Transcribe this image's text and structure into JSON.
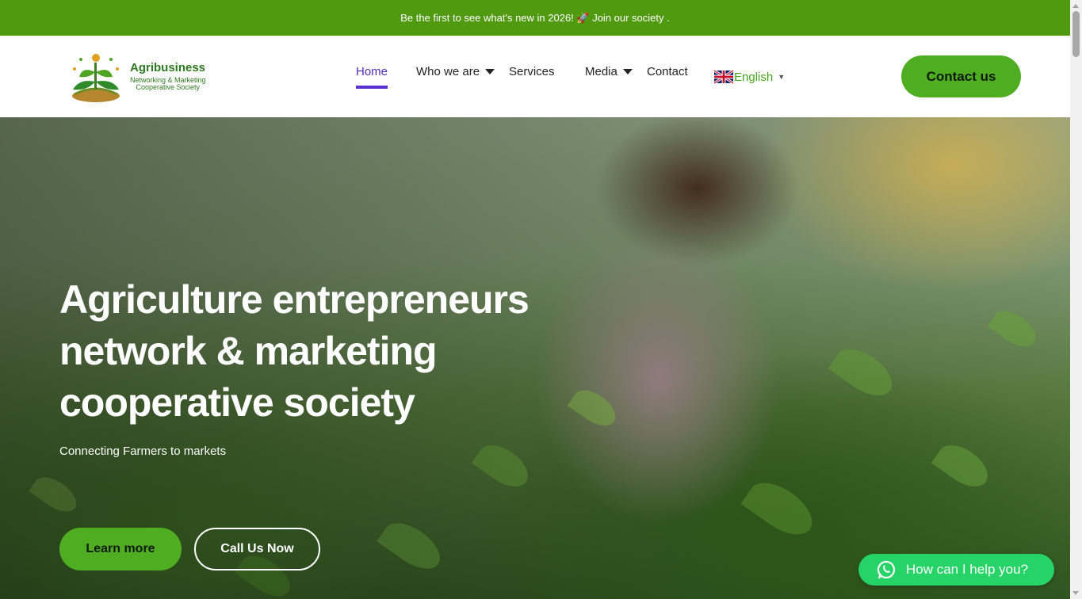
{
  "announcement": {
    "text": "Be the first to see what's new in 2026! 🚀 Join our society ."
  },
  "logo": {
    "line1": "Agribusiness",
    "line2": "Networking & Marketing",
    "line3": "Cooperative Society"
  },
  "nav": {
    "items": [
      {
        "label": "Home",
        "active": true,
        "dropdown": false
      },
      {
        "label": "Who we are",
        "active": false,
        "dropdown": true
      },
      {
        "label": "Services",
        "active": false,
        "dropdown": false
      },
      {
        "label": "Media",
        "active": false,
        "dropdown": true
      },
      {
        "label": "Contact",
        "active": false,
        "dropdown": false
      }
    ],
    "language": "English"
  },
  "header": {
    "contact_button": "Contact us"
  },
  "hero": {
    "title_line1": "Agriculture entrepreneurs",
    "title_line2": "network & marketing",
    "title_line3": "cooperative society",
    "subtitle": "Connecting Farmers to markets",
    "learn_more": "Learn more",
    "call_now": "Call Us Now"
  },
  "whatsapp": {
    "label": "How can I help you?"
  },
  "colors": {
    "brand_green": "#4fad22",
    "topbar_green": "#4f9a0f",
    "active_nav": "#5a2fd0",
    "whatsapp": "#25d366"
  }
}
